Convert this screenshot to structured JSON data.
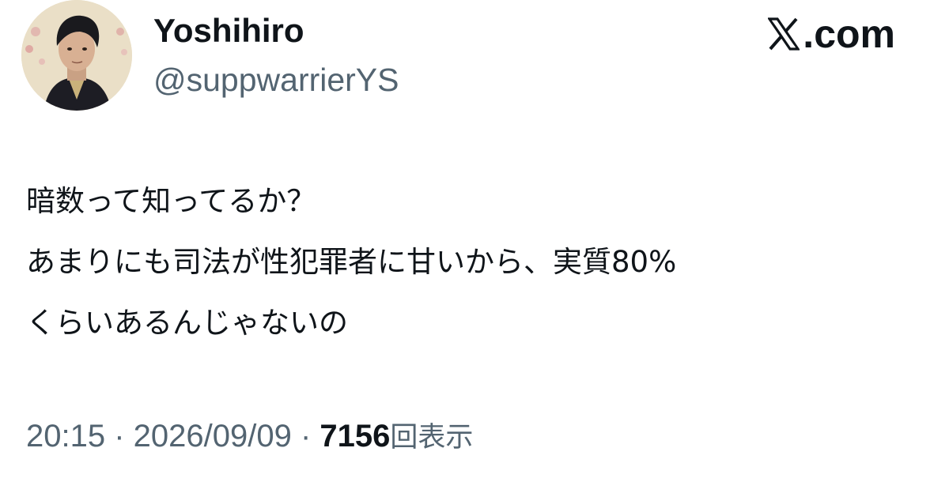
{
  "author": {
    "display_name": "Yoshihiro",
    "handle": "@suppwarrierYS",
    "avatar": "avatar-illustration"
  },
  "brand": {
    "icon": "x-logo-icon",
    "text": ".com"
  },
  "tweet": {
    "lines": [
      "暗数って知ってるか？",
      "あまりにも司法が性犯罪者に甘いから、実質80%",
      "くらいあるんじゃないの"
    ]
  },
  "meta": {
    "time": "20:15",
    "separator": " · ",
    "date": "2026/09/09",
    "views_count": "7156",
    "views_label": "回表示"
  }
}
